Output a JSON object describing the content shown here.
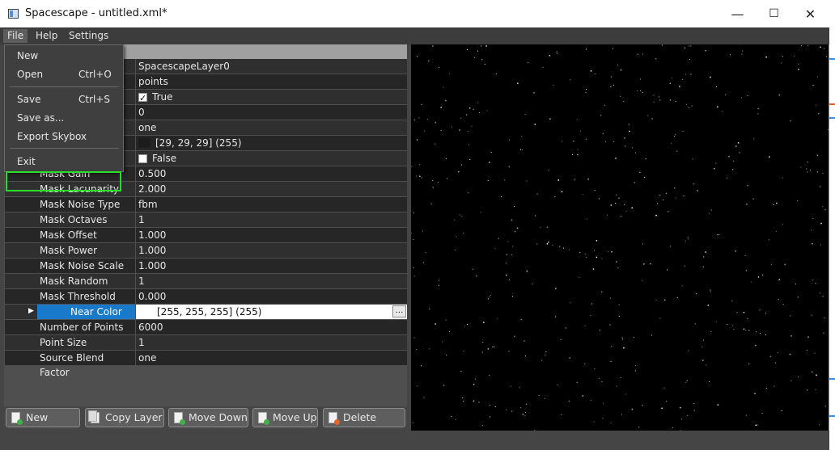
{
  "window": {
    "title": "Spacescape - untitled.xml*",
    "controls": {
      "minimize": "—",
      "maximize": "☐",
      "close": "✕"
    }
  },
  "menubar": {
    "items": [
      {
        "label": "File"
      },
      {
        "label": "Help"
      },
      {
        "label": "Settings"
      }
    ]
  },
  "file_menu": {
    "items": [
      {
        "label": "New",
        "shortcut": ""
      },
      {
        "label": "Open",
        "shortcut": "Ctrl+O"
      },
      {
        "label": "Save",
        "shortcut": "Ctrl+S"
      },
      {
        "label": "Save as...",
        "shortcut": ""
      },
      {
        "label": "Export Skybox",
        "shortcut": ""
      },
      {
        "label": "Exit",
        "shortcut": ""
      }
    ]
  },
  "properties": {
    "rows": [
      {
        "name": "",
        "value": "SpacescapeLayer0"
      },
      {
        "name": "",
        "value": "points"
      },
      {
        "name": "",
        "value": "True",
        "checkbox": true
      },
      {
        "name": "",
        "value": "0"
      },
      {
        "name": "",
        "value": "one"
      },
      {
        "name": "",
        "value": "[29, 29, 29] (255)",
        "swatch": "#1d1d1d"
      },
      {
        "name": "",
        "value": "False",
        "checkbox": false
      },
      {
        "name": "Mask Gain",
        "value": "0.500"
      },
      {
        "name": "Mask Lacunarity",
        "value": "2.000"
      },
      {
        "name": "Mask Noise Type",
        "value": "fbm"
      },
      {
        "name": "Mask Octaves",
        "value": "1"
      },
      {
        "name": "Mask Offset",
        "value": "1.000"
      },
      {
        "name": "Mask Power",
        "value": "1.000"
      },
      {
        "name": "Mask Noise Scale",
        "value": "1.000"
      },
      {
        "name": "Mask Random Seed",
        "value": "1"
      },
      {
        "name": "Mask Threshold",
        "value": "0.000"
      },
      {
        "name": "Near Color",
        "value": "[255, 255, 255] (255)",
        "swatch": "#ffffff",
        "selected": true,
        "ellipsis": "..."
      },
      {
        "name": "Number of Points",
        "value": "6000"
      },
      {
        "name": "Point Size",
        "value": "1"
      },
      {
        "name": "Source Blend Factor",
        "value": "one"
      }
    ]
  },
  "toolbar": {
    "buttons": [
      {
        "label": "New Layer",
        "icon": "new-layer-icon",
        "badge": "#3fb04a"
      },
      {
        "label": "Copy Layer",
        "icon": "copy-layer-icon",
        "badge": ""
      },
      {
        "label": "Move Down",
        "icon": "move-down-icon",
        "badge": "#3fb04a"
      },
      {
        "label": "Move Up",
        "icon": "move-up-icon",
        "badge": "#3fb04a"
      },
      {
        "label": "Delete Layer",
        "icon": "delete-layer-icon",
        "badge": "#e0662a"
      }
    ]
  },
  "colors": {
    "highlight_box": "#29e029",
    "selection": "#1979ca",
    "viewport_bg": "#000000"
  }
}
